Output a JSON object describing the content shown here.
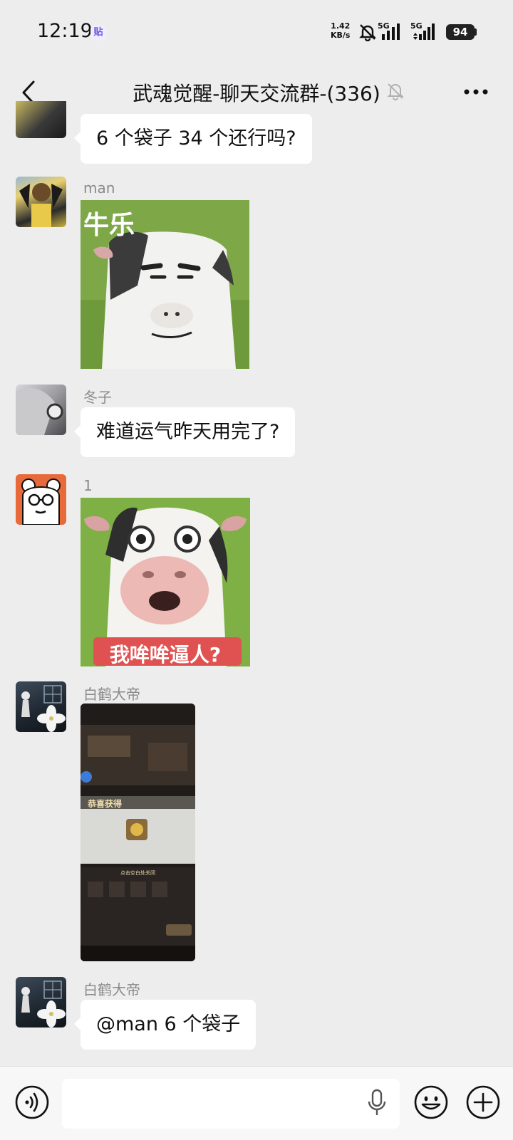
{
  "status_bar": {
    "time": "12:19",
    "app_badge": "贴",
    "speed_value": "1.42",
    "speed_unit": "KB/s",
    "net1": "5G",
    "net2": "5G",
    "battery": "94"
  },
  "header": {
    "title": "武魂觉醒-聊天交流群-(336)"
  },
  "messages": [
    {
      "sender": "",
      "type": "text",
      "text": "6 个袋子 34 个还行吗?"
    },
    {
      "sender": "man",
      "type": "sticker",
      "caption": "牛乐"
    },
    {
      "sender": "冬子",
      "type": "text",
      "text": "难道运气昨天用完了?"
    },
    {
      "sender": "1",
      "type": "sticker",
      "caption": "我哞哞逼人?"
    },
    {
      "sender": "白鹤大帝",
      "type": "screenshot",
      "texts": [
        "恭喜获得",
        "点击空白处关闭"
      ]
    },
    {
      "sender": "白鹤大帝",
      "type": "text",
      "text": "@man 6 个袋子"
    }
  ],
  "colors": {
    "background": "#ededed",
    "bubble": "#ffffff",
    "sender": "#8a8a8a",
    "sticker_green": "#7fa84a"
  },
  "icons": [
    "back-icon",
    "mute-icon",
    "more-icon",
    "voice-icon",
    "mic-icon",
    "emoji-icon",
    "plus-icon"
  ]
}
